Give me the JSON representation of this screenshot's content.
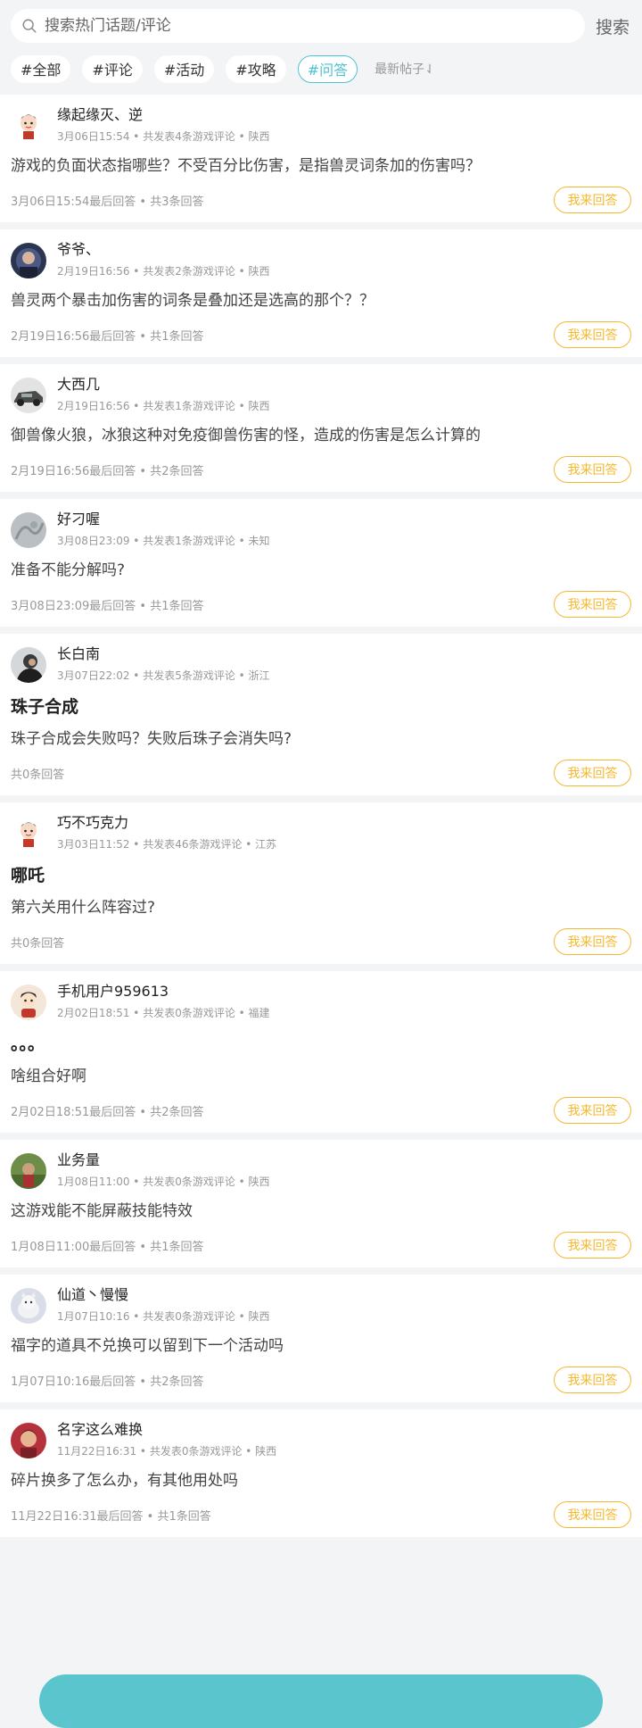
{
  "search": {
    "placeholder": "搜索热门话题/评论",
    "button_label": "搜索"
  },
  "tags": [
    {
      "label": "#全部",
      "active": false
    },
    {
      "label": "#评论",
      "active": false
    },
    {
      "label": "#活动",
      "active": false
    },
    {
      "label": "#攻略",
      "active": false
    },
    {
      "label": "#问答",
      "active": true
    }
  ],
  "sort_label": "最新帖子⇃",
  "reply_label": "我来回答",
  "posts": [
    {
      "author": "缘起缘灭、逆",
      "meta": "3月06日15:54 • 共发表4条游戏评论 • 陕西",
      "title": "",
      "body": "游戏的负面状态指哪些？不受百分比伤害，是指兽灵词条加的伤害吗？",
      "footer": "3月06日15:54最后回答 • 共3条回答",
      "avatar_icon": "cartoon-avatar-icon"
    },
    {
      "author": "爷爷、",
      "meta": "2月19日16:56 • 共发表2条游戏评论 • 陕西",
      "title": "",
      "body": "兽灵两个暴击加伤害的词条是叠加还是选高的那个？？",
      "footer": "2月19日16:56最后回答 • 共1条回答",
      "avatar_icon": "photo-avatar-icon"
    },
    {
      "author": "大西几",
      "meta": "2月19日16:56 • 共发表1条游戏评论 • 陕西",
      "title": "",
      "body": "御兽像火狼，冰狼这种对免疫御兽伤害的怪，造成的伤害是怎么计算的",
      "footer": "2月19日16:56最后回答 • 共2条回答",
      "avatar_icon": "car-avatar-icon"
    },
    {
      "author": "好刁喔",
      "meta": "3月08日23:09 • 共发表1条游戏评论 • 未知",
      "title": "",
      "body": "准备不能分解吗?",
      "footer": "3月08日23:09最后回答 • 共1条回答",
      "avatar_icon": "sketch-avatar-icon"
    },
    {
      "author": "长白南",
      "meta": "3月07日22:02 • 共发表5条游戏评论 • 浙江",
      "title": "珠子合成",
      "body": "珠子合成会失败吗？失败后珠子会消失吗?",
      "footer": "共0条回答",
      "avatar_icon": "portrait-avatar-icon"
    },
    {
      "author": "巧不巧克力",
      "meta": "3月03日11:52 • 共发表46条游戏评论 • 江苏",
      "title": "哪吒",
      "body": "第六关用什么阵容过?",
      "footer": "共0条回答",
      "avatar_icon": "cartoon-avatar-icon"
    },
    {
      "author": "手机用户959613",
      "meta": "2月02日18:51 • 共发表0条游戏评论 • 福建",
      "title": "。。。",
      "body": "啥组合好啊",
      "footer": "2月02日18:51最后回答 • 共2条回答",
      "avatar_icon": "default-avatar-icon"
    },
    {
      "author": "业务量",
      "meta": "1月08日11:00 • 共发表0条游戏评论 • 陕西",
      "title": "",
      "body": "这游戏能不能屏蔽技能特效",
      "footer": "1月08日11:00最后回答 • 共1条回答",
      "avatar_icon": "outdoor-avatar-icon"
    },
    {
      "author": "仙道丶慢慢",
      "meta": "1月07日10:16 • 共发表0条游戏评论 • 陕西",
      "title": "",
      "body": "福字的道具不兑换可以留到下一个活动吗",
      "footer": "1月07日10:16最后回答 • 共2条回答",
      "avatar_icon": "pet-avatar-icon"
    },
    {
      "author": "名字这么难换",
      "meta": "11月22日16:31 • 共发表0条游戏评论 • 陕西",
      "title": "",
      "body": "碎片换多了怎么办，有其他用处吗",
      "footer": "11月22日16:31最后回答 • 共1条回答",
      "avatar_icon": "red-avatar-icon"
    }
  ]
}
